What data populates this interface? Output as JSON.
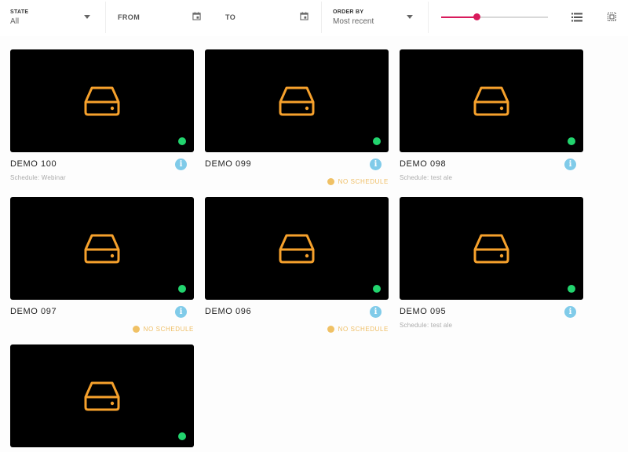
{
  "filters": {
    "state": {
      "label": "STATE",
      "value": "All"
    },
    "from": {
      "label": "FROM"
    },
    "to": {
      "label": "TO"
    },
    "order_by": {
      "label": "ORDER BY",
      "value": "Most recent"
    }
  },
  "zoom_slider": {
    "value_fraction": 0.33
  },
  "colors": {
    "accent": "#d81b5c",
    "drive_icon": "#f6a12c",
    "online_dot": "#22d46e",
    "info": "#80cbe9",
    "no_schedule": "#f0c165"
  },
  "icons": {
    "view_list": "list-view-icon",
    "view_grid": "grid-view-icon",
    "calendar": "calendar-icon",
    "device": "hard-drive-icon",
    "info": "info-icon"
  },
  "cards": [
    {
      "title": "DEMO 100",
      "subtitle": "Schedule: Webinar",
      "no_schedule": "",
      "status": "online"
    },
    {
      "title": "DEMO 099",
      "subtitle": "",
      "no_schedule": "NO SCHEDULE",
      "status": "online"
    },
    {
      "title": "DEMO 098",
      "subtitle": "Schedule: test ale",
      "no_schedule": "",
      "status": "online"
    },
    {
      "title": "DEMO 097",
      "subtitle": "",
      "no_schedule": "NO SCHEDULE",
      "status": "online"
    },
    {
      "title": "DEMO 096",
      "subtitle": "",
      "no_schedule": "NO SCHEDULE",
      "status": "online"
    },
    {
      "title": "DEMO 095",
      "subtitle": "Schedule: test ale",
      "no_schedule": "",
      "status": "online"
    },
    {
      "title": "",
      "subtitle": "",
      "no_schedule": "",
      "status": "online"
    }
  ]
}
